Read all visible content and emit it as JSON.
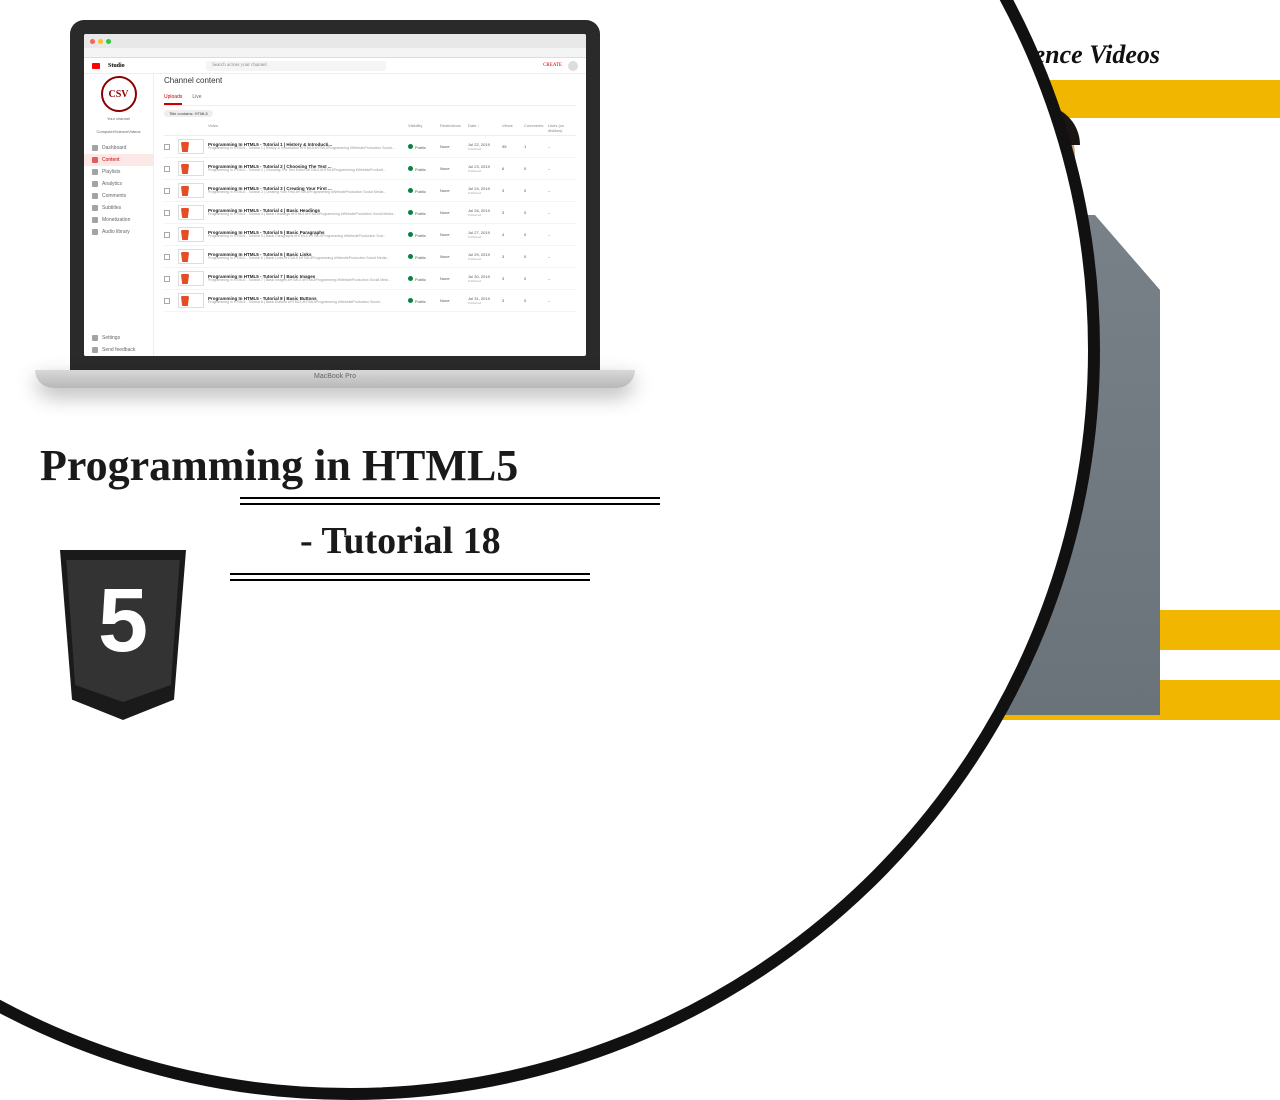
{
  "channel_title": "Computer Science Videos",
  "main_title": "Programming in HTML5",
  "sub_title": "- Tutorial 18",
  "html5_number": "5",
  "laptop_label": "MacBook Pro",
  "studio": {
    "app_name": "Studio",
    "search_placeholder": "Search across your channel",
    "create_label": "CREATE",
    "channel_badge": "CSV",
    "your_channel": "Your channel",
    "channel_sub": "ComputerScienceVideos",
    "nav": [
      {
        "label": "Dashboard"
      },
      {
        "label": "Content"
      },
      {
        "label": "Playlists"
      },
      {
        "label": "Analytics"
      },
      {
        "label": "Comments"
      },
      {
        "label": "Subtitles"
      },
      {
        "label": "Monetization"
      },
      {
        "label": "Audio library"
      }
    ],
    "nav_bottom": [
      {
        "label": "Settings"
      },
      {
        "label": "Send feedback"
      }
    ],
    "page_title": "Channel content",
    "tabs": [
      {
        "label": "Uploads",
        "active": true
      },
      {
        "label": "Live"
      }
    ],
    "filter": "Title contains: HTML5",
    "columns": [
      "",
      "",
      "Video",
      "Visibility",
      "Restrictions",
      "Date ↓",
      "Views",
      "Comments",
      "Likes (vs. dislikes)"
    ],
    "rows": [
      {
        "title": "Programming In HTML5 - Tutorial 1 | History & Introducti...",
        "desc": "Programming In HTML5 - Tutorial 1 | History & Introduction #HTML5 #HTML5Programming #WebsiteProduction Social...",
        "visibility": "Public",
        "restrictions": "None",
        "date": "Jul 22, 2019",
        "pub": "Published",
        "views": "95",
        "comments": "1",
        "likes": "–"
      },
      {
        "title": "Programming In HTML5 - Tutorial 2 | Choosing The Text ...",
        "desc": "Programming In HTML5 - Tutorial 2 | Choosing The Text Editor #HTML5 #HTML5Programming #WebsiteProducti...",
        "visibility": "Public",
        "restrictions": "None",
        "date": "Jul 23, 2019",
        "pub": "Published",
        "views": "6",
        "comments": "0",
        "likes": "–"
      },
      {
        "title": "Programming In HTML5 - Tutorial 3 | Creating Your First ...",
        "desc": "Programming In HTML5 - Tutorial 3 | Creating Your First #HTML5Programming #WebsiteProduction Social Media...",
        "visibility": "Public",
        "restrictions": "None",
        "date": "Jul 24, 2019",
        "pub": "Published",
        "views": "3",
        "comments": "0",
        "likes": "–"
      },
      {
        "title": "Programming In HTML5 - Tutorial 4 | Basic Headings",
        "desc": "Programming In HTML5 - Tutorial 4 | Basic Headings #HTML5 #HTML5Programming #WebsiteProduction Social Media...",
        "visibility": "Public",
        "restrictions": "None",
        "date": "Jul 26, 2019",
        "pub": "Published",
        "views": "3",
        "comments": "0",
        "likes": "–"
      },
      {
        "title": "Programming In HTML5 - Tutorial 5 | Basic Paragraphs",
        "desc": "Programming In HTML5 - Tutorial 5 | Basic Paragraphs #HTML5 #HTML5Programming #WebsiteProduction Soci...",
        "visibility": "Public",
        "restrictions": "None",
        "date": "Jul 27, 2019",
        "pub": "Published",
        "views": "4",
        "comments": "0",
        "likes": "–"
      },
      {
        "title": "Programming In HTML5 - Tutorial 6 | Basic Links",
        "desc": "Programming In HTML5 - Tutorial 6 | Basic Links #HTML5 #HTML5Programming #WebsiteProduction Social Media...",
        "visibility": "Public",
        "restrictions": "None",
        "date": "Jul 29, 2019",
        "pub": "Published",
        "views": "3",
        "comments": "0",
        "likes": "–"
      },
      {
        "title": "Programming In HTML5 - Tutorial 7 | Basic Images",
        "desc": "Programming In HTML5 - Tutorial 7 | Basic Images #HTML5 #HTML5Programming #WebsiteProduction Social Medi...",
        "visibility": "Public",
        "restrictions": "None",
        "date": "Jul 30, 2019",
        "pub": "Published",
        "views": "3",
        "comments": "0",
        "likes": "–"
      },
      {
        "title": "Programming In HTML5 - Tutorial 8 | Basic Buttons",
        "desc": "Programming In HTML5 - Tutorial 8 | Basic Buttons #HTML5 #HTML5Programming #WebsiteProduction Social...",
        "visibility": "Public",
        "restrictions": "None",
        "date": "Jul 31, 2019",
        "pub": "Published",
        "views": "3",
        "comments": "0",
        "likes": "–"
      }
    ]
  }
}
